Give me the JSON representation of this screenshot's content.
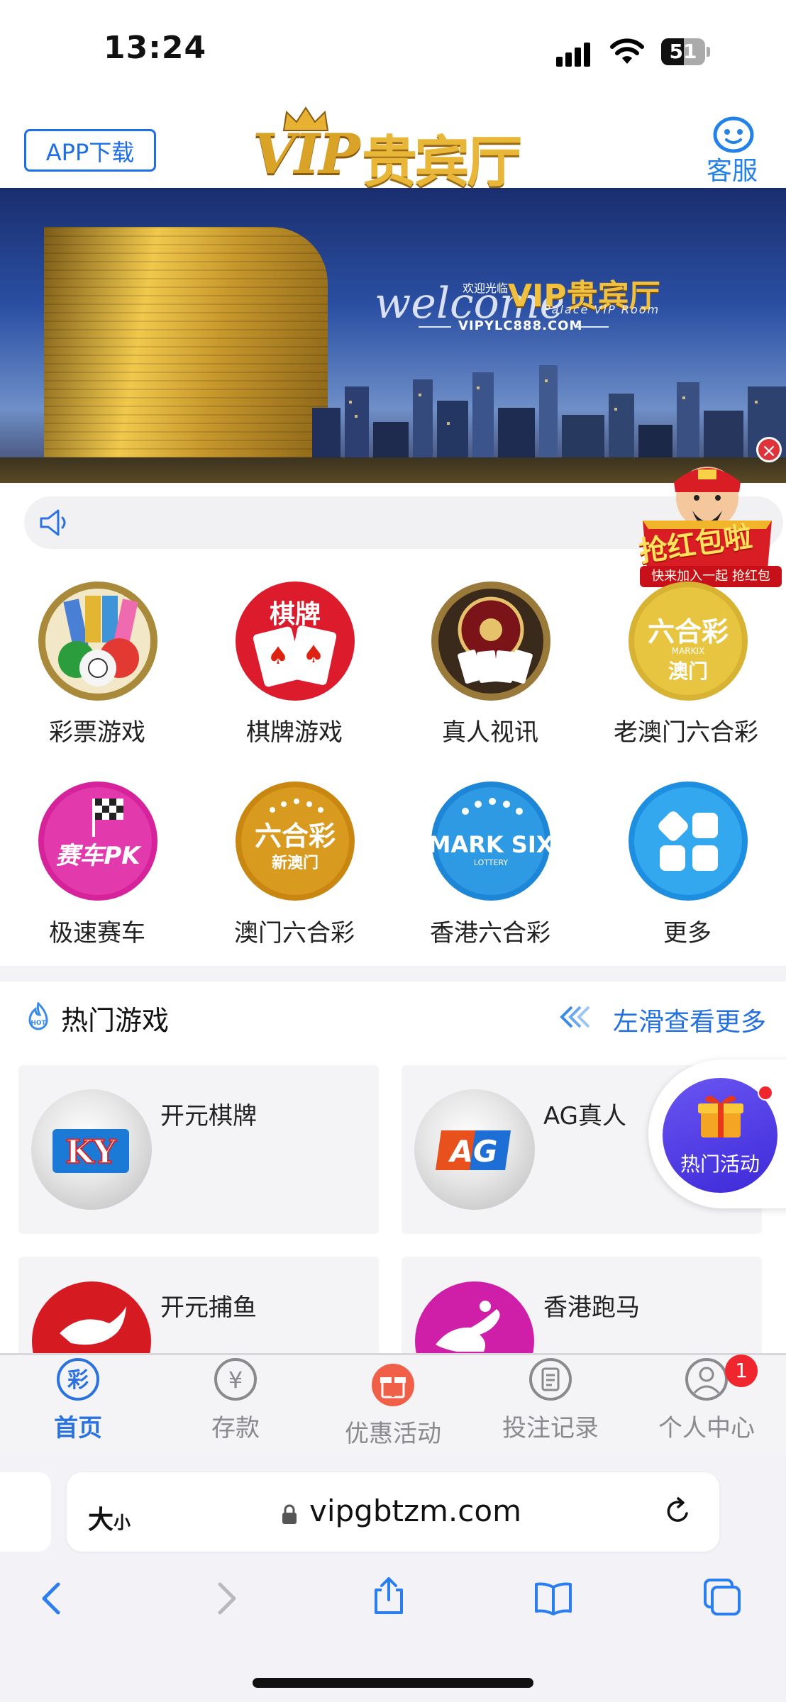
{
  "status_bar": {
    "time": "13:24",
    "battery": "51"
  },
  "header": {
    "app_download": "APP下载",
    "logo_latin": "VIP",
    "logo_cn": "贵宾厅",
    "service_label": "客服"
  },
  "banner": {
    "welcome": "welcome",
    "welcome_cn": "欢迎光临",
    "title": "VIP贵宾厅",
    "subtitle": "Palace VIP Room",
    "url": "VIPYLC888.COM"
  },
  "promo": {
    "title": "抢红包啦",
    "subtitle": "快来加入一起 抢红包"
  },
  "categories": [
    {
      "label": "彩票游戏"
    },
    {
      "label": "棋牌游戏",
      "icon_text": "棋牌"
    },
    {
      "label": "真人视讯"
    },
    {
      "label": "老澳门六合彩",
      "icon_text": "六合彩",
      "icon_sub": "澳门"
    },
    {
      "label": "极速赛车",
      "icon_text": "赛车PK"
    },
    {
      "label": "澳门六合彩",
      "icon_text": "六合彩",
      "icon_sub": "新澳门"
    },
    {
      "label": "香港六合彩",
      "icon_text": "MARK SIX"
    },
    {
      "label": "更多"
    }
  ],
  "hot_games": {
    "title": "热门游戏",
    "more": "左滑查看更多",
    "hot_badge": "HOT",
    "cards": [
      {
        "name": "开元棋牌",
        "logo_text": "KY"
      },
      {
        "name": "AG真人",
        "logo_text": "AG"
      },
      {
        "name": "开元捕鱼"
      },
      {
        "name": "香港跑马"
      }
    ],
    "floating_label": "热门活动"
  },
  "tabbar": {
    "tabs": [
      {
        "label": "首页",
        "icon_glyph": "彩"
      },
      {
        "label": "存款",
        "icon_glyph": "¥"
      },
      {
        "label": "优惠活动"
      },
      {
        "label": "投注记录"
      },
      {
        "label": "个人中心"
      }
    ],
    "active_index": 0,
    "profile_badge": "1"
  },
  "safari": {
    "text_size_big": "大",
    "text_size_small": "小",
    "url": "vipgbtzm.com"
  },
  "colors": {
    "accent_blue": "#2a72e0",
    "badge_red": "#f0262e",
    "gold": "#d9a328"
  }
}
